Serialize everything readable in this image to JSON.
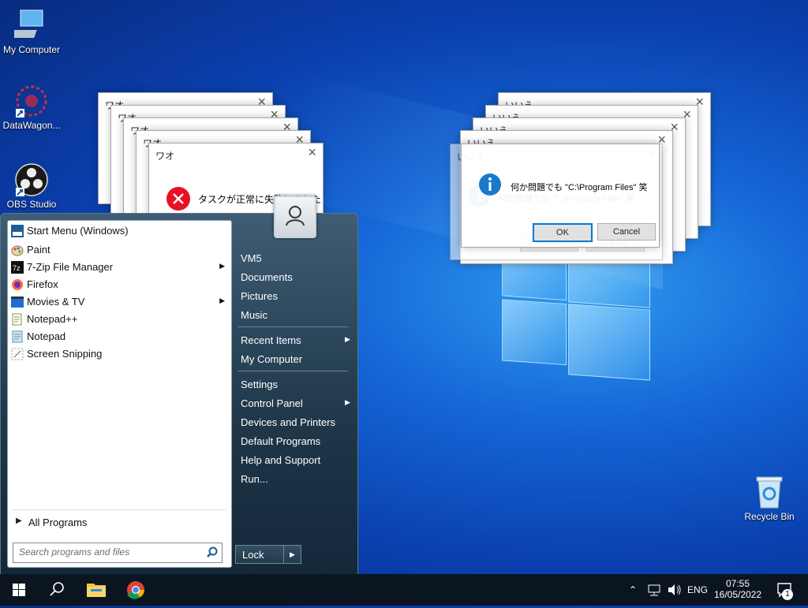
{
  "desktop": {
    "icons": [
      {
        "label": "My Computer"
      },
      {
        "label": "DataWagon..."
      },
      {
        "label": "OBS Studio"
      },
      {
        "label": "Recycle Bin"
      }
    ]
  },
  "dialogs": {
    "error": {
      "title": "ワオ",
      "message": "タスクが正常に失敗しました"
    },
    "info": {
      "title": "いいえ",
      "message": "何か問題でも \"C:\\Program Files\" 笑",
      "ok": "OK",
      "cancel": "Cancel"
    }
  },
  "start_menu": {
    "programs": [
      {
        "label": "Start Menu (Windows)",
        "icon": "start-menu-icon"
      },
      {
        "label": "Paint",
        "icon": "paint-icon"
      },
      {
        "label": "7-Zip File Manager",
        "icon": "7zip-icon"
      },
      {
        "label": "Firefox",
        "icon": "firefox-icon"
      },
      {
        "label": "Movies & TV",
        "icon": "movies-icon"
      },
      {
        "label": "Notepad++",
        "icon": "notepadpp-icon"
      },
      {
        "label": "Notepad",
        "icon": "notepad-icon"
      },
      {
        "label": "Screen Snipping",
        "icon": "snipping-icon"
      }
    ],
    "all_programs": "All Programs",
    "search_placeholder": "Search programs and files",
    "right": {
      "user": "VM5",
      "documents": "Documents",
      "pictures": "Pictures",
      "music": "Music",
      "recent_items": "Recent Items",
      "my_computer": "My Computer",
      "settings": "Settings",
      "control_panel": "Control Panel",
      "devices": "Devices and Printers",
      "default_programs": "Default Programs",
      "help": "Help and Support",
      "run": "Run..."
    },
    "lock": "Lock"
  },
  "taskbar": {
    "language": "ENG",
    "time": "07:55",
    "date": "16/05/2022",
    "notification_count": "1"
  },
  "colors": {
    "accent": "#0078d7",
    "error": "#e81123",
    "info": "#1979ca"
  }
}
